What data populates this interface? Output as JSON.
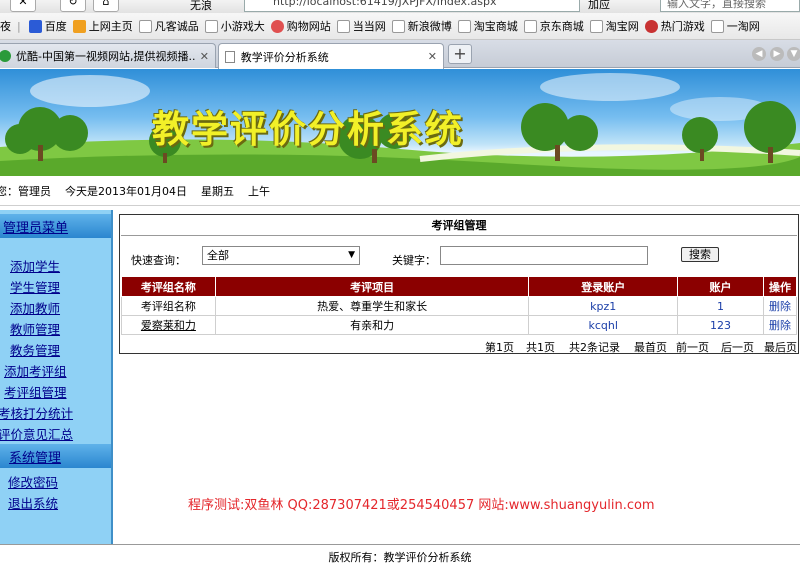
{
  "browser": {
    "toolbar": {
      "title_fragment": "无浪",
      "address": "http://localhost:61419/JXPJFX/Index.aspx",
      "add_button": "加应",
      "search_placeholder": "输入文字，直接搜索"
    },
    "bookmarks": [
      "百度",
      "上网主页",
      "凡客诚品",
      "小游戏大",
      "购物网站",
      "当当网",
      "新浪微博",
      "淘宝商城",
      "京东商城",
      "淘宝网",
      "热门游戏",
      "一淘网"
    ],
    "bookmark_prefix": "夜",
    "tabs": [
      {
        "label": "优酷-中国第一视频网站,提供视频播..."
      },
      {
        "label": "教学评价分析系统"
      }
    ],
    "new_tab": "+"
  },
  "banner": {
    "title": "教学评价分析系统"
  },
  "userbar": {
    "text": "您：管理员    今天是2013年01月04日    星期五    上午"
  },
  "sidebar": {
    "header1": "管理员菜单",
    "items1": [
      "添加学生",
      "学生管理",
      "添加教师",
      "教师管理",
      "教务管理",
      "添加考评组",
      "考评组管理",
      "考核打分统计",
      "评价意见汇总"
    ],
    "header2": "系统管理",
    "items2": [
      "修改密码",
      "退出系统"
    ]
  },
  "main": {
    "title": "考评组管理",
    "search": {
      "quick_label": "快速查询：",
      "select_value": "全部",
      "keyword_label": "关键字：",
      "keyword_value": "",
      "button": "搜索"
    },
    "table": {
      "headers": [
        "考评组名称",
        "考评项目",
        "登录账户",
        "账户",
        "操作"
      ],
      "rows": [
        [
          "考评组名称",
          "热爱、尊重学生和家长",
          "kpz1",
          "1",
          "删除"
        ],
        [
          "爱察莱和力",
          "有亲和力",
          "kcqhl",
          "123",
          "删除"
        ]
      ]
    },
    "pagination": [
      "第1页",
      "共1页",
      "共2条记录",
      "最首页",
      "前一页",
      "后一页",
      "最后页"
    ]
  },
  "credit": "程序测试:双鱼林 QQ:287307421或254540457 网站:www.shuangyulin.com",
  "footer": "版权所有：教学评价分析系统",
  "colors": {
    "header_red": "#8b0000",
    "sidebar_blue": "#8fd1f5",
    "credit_red": "#e4272c"
  }
}
